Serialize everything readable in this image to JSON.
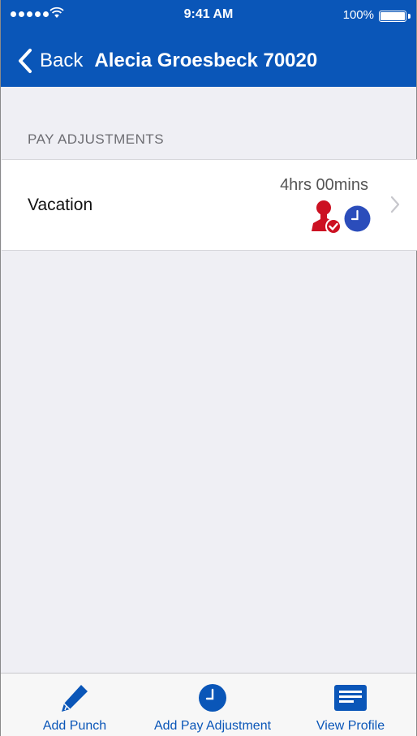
{
  "status_bar": {
    "time": "9:41 AM",
    "battery": "100%"
  },
  "nav": {
    "back_label": "Back",
    "title": "Alecia Groesbeck 70020"
  },
  "section": {
    "label": "PAY ADJUSTMENTS"
  },
  "adjustments": [
    {
      "type": "Vacation",
      "amount": "4hrs 00mins",
      "icons": [
        "approved-person-icon",
        "clock-icon"
      ]
    }
  ],
  "tabbar": {
    "items": [
      {
        "label": "Add Punch",
        "icon": "pencil-icon"
      },
      {
        "label": "Add Pay Adjustment",
        "icon": "clock-icon"
      },
      {
        "label": "View Profile",
        "icon": "profile-card-icon"
      }
    ]
  },
  "colors": {
    "brand_blue": "#0a56b8",
    "approval_red": "#cc1122",
    "clock_blue": "#2b4dbb",
    "background": "#efeff4"
  }
}
